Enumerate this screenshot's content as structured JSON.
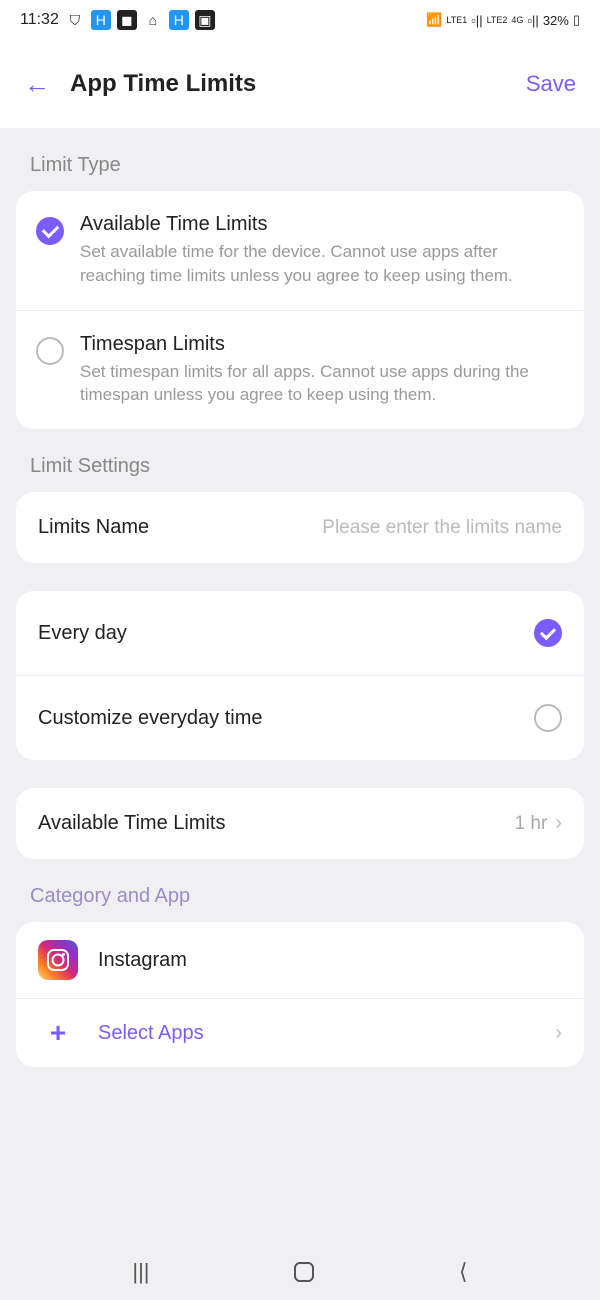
{
  "status_bar": {
    "time": "11:32",
    "battery": "32%",
    "network1": "LTE1",
    "network2": "LTE2",
    "signal": "4G"
  },
  "header": {
    "title": "App Time Limits",
    "save": "Save"
  },
  "sections": {
    "limit_type": {
      "label": "Limit Type",
      "options": [
        {
          "title": "Available Time Limits",
          "desc": "Set available time for the device. Cannot use apps after reaching time limits unless you agree to keep using them.",
          "selected": true
        },
        {
          "title": "Timespan Limits",
          "desc": "Set timespan limits for all apps. Cannot use apps during the timespan unless you agree to keep using them.",
          "selected": false
        }
      ]
    },
    "limit_settings": {
      "label": "Limit Settings",
      "name_label": "Limits Name",
      "name_placeholder": "Please enter the limits name"
    },
    "schedule": {
      "every_day": "Every day",
      "customize": "Customize everyday time",
      "every_day_checked": true
    },
    "available_time": {
      "label": "Available Time Limits",
      "value": "1 hr"
    },
    "category": {
      "label": "Category and App",
      "apps": [
        {
          "name": "Instagram",
          "icon": "instagram"
        }
      ],
      "select_apps": "Select Apps"
    }
  }
}
